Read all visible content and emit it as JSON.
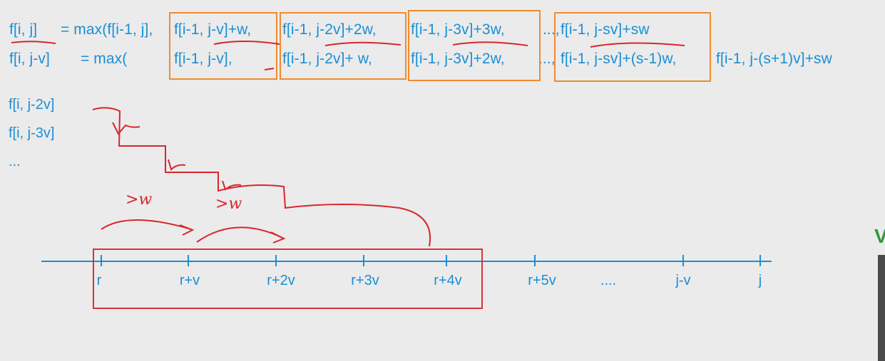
{
  "formula_row1": {
    "lhs": "f[i, j]",
    "op": "= max(f[i-1, j],",
    "t1": "f[i-1, j-v]+w,",
    "t2": "f[i-1, j-2v]+2w,",
    "t3": "f[i-1, j-3v]+3w,",
    "dots": "...,",
    "t4": "f[i-1, j-sv]+sw"
  },
  "formula_row2": {
    "lhs": "f[i, j-v]",
    "op": "= max(",
    "t1": "f[i-1, j-v],",
    "t2": "f[i-1, j-2v]+  w,",
    "t3": "f[i-1, j-3v]+2w,",
    "dots": "...,",
    "t4": "f[i-1, j-sv]+(s-1)w,",
    "t5": "f[i-1, j-(s+1)v]+sw"
  },
  "side_items": [
    "f[i, j-2v]",
    "f[i, j-3v]",
    "..."
  ],
  "number_line": {
    "labels": [
      "r",
      "r+v",
      "r+2v",
      "r+3v",
      "r+4v",
      "r+5v",
      "....",
      "j-v",
      "j"
    ]
  },
  "annotations": {
    "note1": ">w",
    "note2": ">w"
  },
  "edge_glyph": "V",
  "colors": {
    "background": "#ebebeb",
    "text": "#1a8fd6",
    "orange_box": "#f28a2e",
    "red_ink": "#d8262d",
    "red_box": "#d6333a"
  }
}
